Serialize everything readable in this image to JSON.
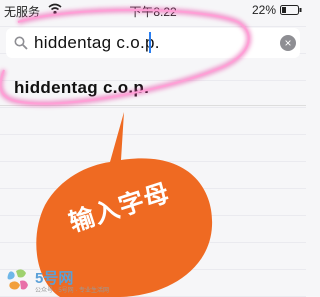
{
  "status_bar": {
    "carrier": "无服务",
    "time": "下午8:22",
    "battery": "22%"
  },
  "search": {
    "query": "hiddentag c.o.p.",
    "icon": "search-icon",
    "clear_icon": "×"
  },
  "suggestion": {
    "text": "hiddentag c.o.p."
  },
  "callout": {
    "text": "输入字母",
    "color": "#ef6a22"
  },
  "highlight": {
    "color": "#e93fa4"
  },
  "watermark": {
    "name": "5号网",
    "sub": "公众号 · 5号网 · 专业生活网"
  }
}
